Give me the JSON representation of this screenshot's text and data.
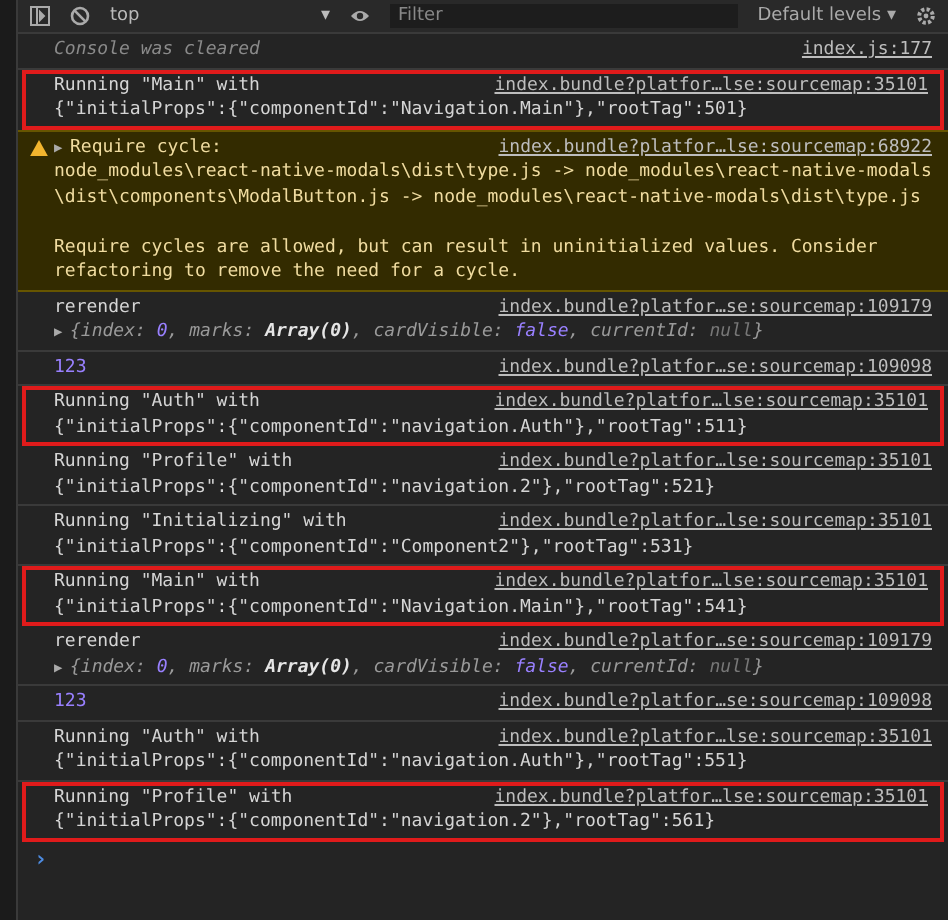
{
  "toolbar": {
    "context": "top",
    "context_caret": "▾",
    "filter": {
      "placeholder": "Filter"
    },
    "levels": "Default levels",
    "levels_caret": "▾"
  },
  "messages": [
    {
      "kind": "info",
      "lines": [
        "Console was cleared"
      ],
      "source": "index.js:177",
      "highlighted": false
    },
    {
      "kind": "log",
      "lines": [
        "Running \"Main\" with",
        "{\"initialProps\":{\"componentId\":\"Navigation.Main\"},\"rootTag\":501}"
      ],
      "source": "index.bundle?platfor…lse:sourcemap:35101",
      "highlighted": true
    },
    {
      "kind": "warning",
      "toggle": "▶",
      "lines": [
        "Require cycle:",
        "node_modules\\react-native-modals\\dist\\type.js -> node_modules\\react-native-modals\\dist\\components\\ModalButton.js -> node_modules\\react-native-modals\\dist\\type.js",
        "Require cycles are allowed, but can result in uninitialized values. Consider refactoring to remove the need for a cycle."
      ],
      "source": "index.bundle?platfor…lse:sourcemap:68922",
      "highlighted": false
    },
    {
      "kind": "object",
      "lines": [
        "rerender"
      ],
      "toggle": "▶",
      "preview": [
        {
          "text": "{index: ",
          "kind": "key"
        },
        {
          "text": "0",
          "kind": "number"
        },
        {
          "text": ", marks: ",
          "kind": "key"
        },
        {
          "text": "Array(0)",
          "kind": "array"
        },
        {
          "text": ", cardVisible: ",
          "kind": "key"
        },
        {
          "text": "false",
          "kind": "boolean"
        },
        {
          "text": ", currentId: ",
          "kind": "key"
        },
        {
          "text": "null",
          "kind": "null"
        },
        {
          "text": "}",
          "kind": "key"
        }
      ],
      "source": "index.bundle?platfor…se:sourcemap:109179",
      "highlighted": false
    },
    {
      "kind": "number",
      "lines": [
        "123"
      ],
      "source": "index.bundle?platfor…se:sourcemap:109098",
      "highlighted": false
    },
    {
      "kind": "log",
      "lines": [
        "Running \"Auth\" with",
        "{\"initialProps\":{\"componentId\":\"navigation.Auth\"},\"rootTag\":511}"
      ],
      "source": "index.bundle?platfor…lse:sourcemap:35101",
      "highlighted": true
    },
    {
      "kind": "log",
      "lines": [
        "Running \"Profile\" with",
        "{\"initialProps\":{\"componentId\":\"navigation.2\"},\"rootTag\":521}"
      ],
      "source": "index.bundle?platfor…lse:sourcemap:35101",
      "highlighted": false
    },
    {
      "kind": "log",
      "lines": [
        "Running \"Initializing\" with",
        "{\"initialProps\":{\"componentId\":\"Component2\"},\"rootTag\":531}"
      ],
      "source": "index.bundle?platfor…lse:sourcemap:35101",
      "highlighted": false
    },
    {
      "kind": "log",
      "lines": [
        "Running \"Main\" with",
        "{\"initialProps\":{\"componentId\":\"Navigation.Main\"},\"rootTag\":541}"
      ],
      "source": "index.bundle?platfor…lse:sourcemap:35101",
      "highlighted": true
    },
    {
      "kind": "object",
      "lines": [
        "rerender"
      ],
      "toggle": "▶",
      "preview": [
        {
          "text": "{index: ",
          "kind": "key"
        },
        {
          "text": "0",
          "kind": "number"
        },
        {
          "text": ", marks: ",
          "kind": "key"
        },
        {
          "text": "Array(0)",
          "kind": "array"
        },
        {
          "text": ", cardVisible: ",
          "kind": "key"
        },
        {
          "text": "false",
          "kind": "boolean"
        },
        {
          "text": ", currentId: ",
          "kind": "key"
        },
        {
          "text": "null",
          "kind": "null"
        },
        {
          "text": "}",
          "kind": "key"
        }
      ],
      "source": "index.bundle?platfor…se:sourcemap:109179",
      "highlighted": false
    },
    {
      "kind": "number",
      "lines": [
        "123"
      ],
      "source": "index.bundle?platfor…se:sourcemap:109098",
      "highlighted": false
    },
    {
      "kind": "log",
      "lines": [
        "Running \"Auth\" with",
        "{\"initialProps\":{\"componentId\":\"navigation.Auth\"},\"rootTag\":551}"
      ],
      "source": "index.bundle?platfor…lse:sourcemap:35101",
      "highlighted": false
    },
    {
      "kind": "log",
      "lines": [
        "Running \"Profile\" with",
        "{\"initialProps\":{\"componentId\":\"navigation.2\"},\"rootTag\":561}"
      ],
      "source": "index.bundle?platfor…lse:sourcemap:35101",
      "highlighted": true
    }
  ],
  "prompt": "›"
}
